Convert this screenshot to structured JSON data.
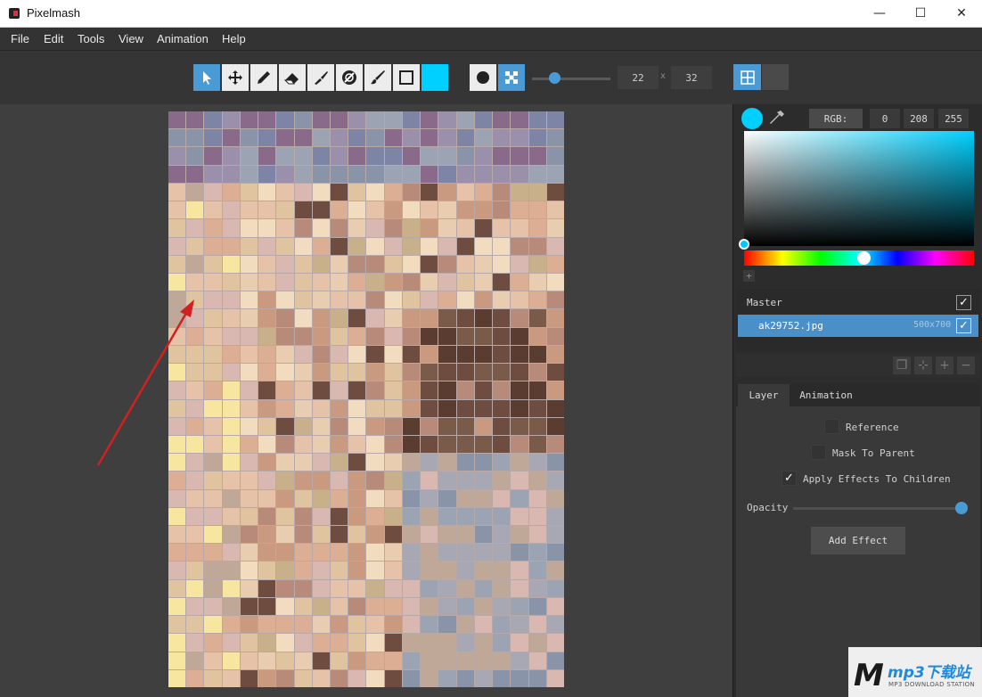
{
  "window": {
    "title": "Pixelmash",
    "minimize": "—",
    "maximize": "☐",
    "close": "✕"
  },
  "menu": [
    "File",
    "Edit",
    "Tools",
    "View",
    "Animation",
    "Help"
  ],
  "toolbar": {
    "tools": [
      "select-arrow-icon",
      "move-icon",
      "pencil-icon",
      "eraser-icon",
      "brush-icon",
      "fill-icon",
      "paint-brush-icon",
      "rectangle-icon"
    ],
    "active_tool": "select-arrow-icon",
    "current_color": "#00d0ff",
    "grid_width": "22",
    "grid_height": "32",
    "size_separator": "x",
    "brush_size_level": 0.27
  },
  "color_picker": {
    "mode_label": "RGB:",
    "r": "0",
    "g": "208",
    "b": "255",
    "color": "#00d0ff",
    "add_label": "+"
  },
  "layers": {
    "master_label": "Master",
    "items": [
      {
        "name": "ak29752.jpg",
        "size": "500x700"
      }
    ]
  },
  "tabs": [
    "Layer",
    "Animation"
  ],
  "layer_props": {
    "reference_label": "Reference",
    "mask_label": "Mask To Parent",
    "apply_label": "Apply Effects To Children",
    "opacity_label": "Opacity",
    "opacity_value": 1.0,
    "add_effect_label": "Add Effect"
  },
  "watermark": {
    "logo": "M",
    "text": "mp3下载站",
    "sub": "MP3 DOWNLOAD STATION"
  }
}
